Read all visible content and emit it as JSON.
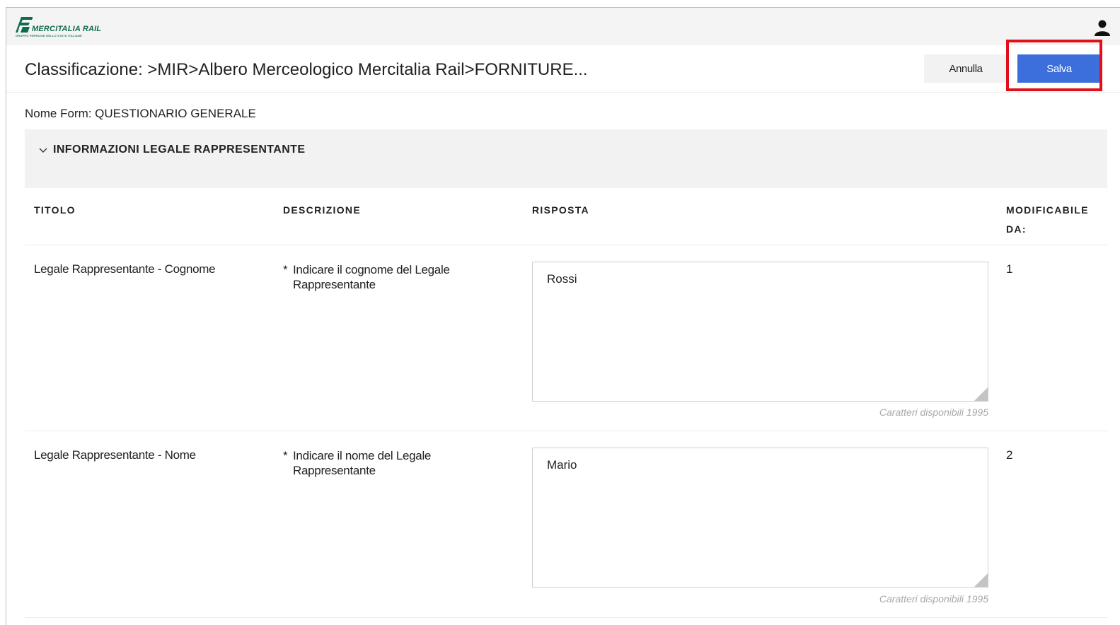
{
  "brand": {
    "name": "MERCITALIA RAIL",
    "group": "GRUPPO FERROVIE DELLO STATO ITALIANE",
    "logo_color": "#0f6b4c"
  },
  "header": {
    "title": "Classificazione: >MIR>Albero Merceologico Mercitalia Rail>FORNITURE...",
    "cancel_label": "Annulla",
    "save_label": "Salva",
    "save_color": "#3d6fdc",
    "highlight_color": "#e0101a"
  },
  "user_icon": "user-icon",
  "form": {
    "name": "Nome Form: QUESTIONARIO GENERALE"
  },
  "section": {
    "title": "INFORMAZIONI LEGALE RAPPRESENTANTE",
    "icon": "chevron-down-icon",
    "expanded": true
  },
  "table": {
    "headers": {
      "titolo": "TITOLO",
      "descrizione": "DESCRIZIONE",
      "risposta": "RISPOSTA",
      "modificabile": "MODIFICABILE DA:"
    },
    "rows": [
      {
        "titolo": "Legale Rappresentante - Cognome",
        "required": "*",
        "descrizione": "Indicare il cognome del Legale Rappresentante",
        "risposta": "Rossi",
        "counter": "Caratteri disponibili 1995",
        "modificabile": "1"
      },
      {
        "titolo": "Legale Rappresentante - Nome",
        "required": "*",
        "descrizione": "Indicare il nome del Legale Rappresentante",
        "risposta": "Mario",
        "counter": "Caratteri disponibili 1995",
        "modificabile": "2"
      }
    ]
  }
}
